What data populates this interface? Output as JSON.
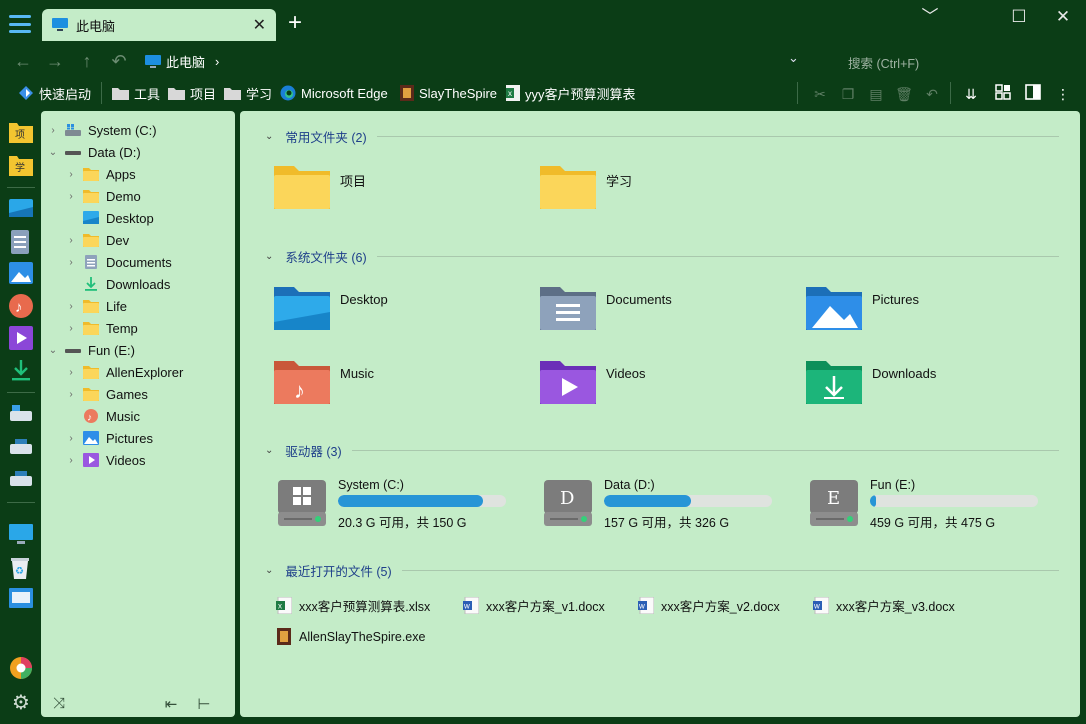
{
  "tab": {
    "title": "此电脑",
    "close": "✕"
  },
  "window": {
    "new_tab": "+",
    "minimize": "﹀",
    "maximize": "☐",
    "close": "✕"
  },
  "address": {
    "breadcrumb": "此电脑",
    "separator": "›",
    "dropdown": "⌄",
    "search_placeholder": "搜索 (Ctrl+F)"
  },
  "toolbar": {
    "quick_launch": "快速启动",
    "items": [
      "工具",
      "项目",
      "学习",
      "Microsoft Edge",
      "SlayTheSpire",
      "yyy客户预算测算表"
    ]
  },
  "rail": {
    "item1_badge": "项",
    "item2_badge": "学"
  },
  "tree": {
    "items": [
      {
        "label": "System (C:)",
        "chev": "›"
      },
      {
        "label": "Data (D:)",
        "chev": "⌄"
      },
      {
        "label": "Apps",
        "chev": "›"
      },
      {
        "label": "Demo",
        "chev": "›"
      },
      {
        "label": "Desktop",
        "chev": ""
      },
      {
        "label": "Dev",
        "chev": "›"
      },
      {
        "label": "Documents",
        "chev": "›"
      },
      {
        "label": "Downloads",
        "chev": ""
      },
      {
        "label": "Life",
        "chev": "›"
      },
      {
        "label": "Temp",
        "chev": "›"
      },
      {
        "label": "Fun (E:)",
        "chev": "⌄"
      },
      {
        "label": "AllenExplorer",
        "chev": "›"
      },
      {
        "label": "Games",
        "chev": "›"
      },
      {
        "label": "Music",
        "chev": ""
      },
      {
        "label": "Pictures",
        "chev": "›"
      },
      {
        "label": "Videos",
        "chev": "›"
      }
    ]
  },
  "groups": {
    "common": {
      "title": "常用文件夹 (2)",
      "items": [
        "项目",
        "学习"
      ]
    },
    "system": {
      "title": "系统文件夹 (6)",
      "items": [
        "Desktop",
        "Documents",
        "Pictures",
        "Music",
        "Videos",
        "Downloads"
      ]
    },
    "drives": {
      "title": "驱动器 (3)",
      "items": [
        {
          "name": "System (C:)",
          "info": "20.3 G 可用，共 150 G",
          "used": 0.865,
          "letter": ""
        },
        {
          "name": "Data (D:)",
          "info": "157 G 可用，共 326 G",
          "used": 0.52,
          "letter": "D"
        },
        {
          "name": "Fun (E:)",
          "info": "459 G 可用，共 475 G",
          "used": 0.034,
          "letter": "E"
        }
      ]
    },
    "recent": {
      "title": "最近打开的文件 (5)",
      "items": [
        "xxx客户预算测算表.xlsx",
        "xxx客户方案_v1.docx",
        "xxx客户方案_v2.docx",
        "xxx客户方案_v3.docx",
        "AllenSlayTheSpire.exe"
      ]
    }
  },
  "colors": {
    "accent": "#2795d6",
    "pane_bg": "#c4ecc8",
    "frame_bg": "#0b3d16",
    "group_title": "#1e3f8a"
  }
}
